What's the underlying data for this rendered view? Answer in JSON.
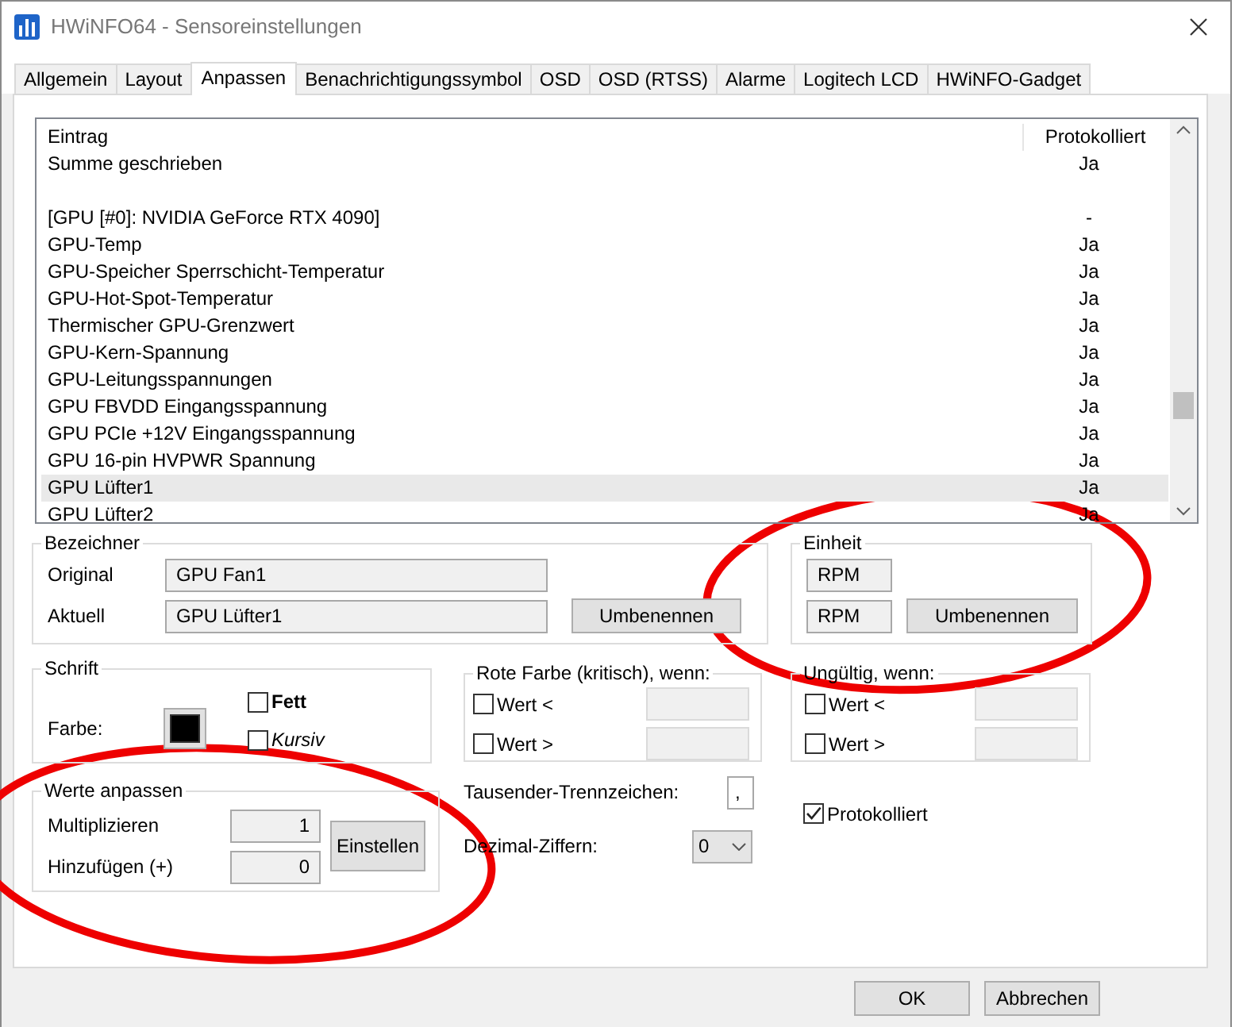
{
  "window": {
    "title": "HWiNFO64 - Sensoreinstellungen"
  },
  "tabs": [
    {
      "label": "Allgemein",
      "selected": false
    },
    {
      "label": "Layout",
      "selected": false
    },
    {
      "label": "Anpassen",
      "selected": true
    },
    {
      "label": "Benachrichtigungssymbol",
      "selected": false
    },
    {
      "label": "OSD",
      "selected": false
    },
    {
      "label": "OSD (RTSS)",
      "selected": false
    },
    {
      "label": "Alarme",
      "selected": false
    },
    {
      "label": "Logitech LCD",
      "selected": false
    },
    {
      "label": "HWiNFO-Gadget",
      "selected": false
    }
  ],
  "sensor_list": {
    "columns": [
      "Eintrag",
      "Protokolliert"
    ],
    "rows": [
      {
        "kind": "entry",
        "entry": "Summe geschrieben",
        "logged": "Ja",
        "selected": false
      },
      {
        "kind": "spacer"
      },
      {
        "kind": "entry",
        "entry": "[GPU [#0]: NVIDIA GeForce RTX 4090]",
        "logged": "-",
        "selected": false
      },
      {
        "kind": "entry",
        "entry": "GPU-Temp",
        "logged": "Ja",
        "selected": false
      },
      {
        "kind": "entry",
        "entry": "GPU-Speicher Sperrschicht-Temperatur",
        "logged": "Ja",
        "selected": false
      },
      {
        "kind": "entry",
        "entry": "GPU-Hot-Spot-Temperatur",
        "logged": "Ja",
        "selected": false
      },
      {
        "kind": "entry",
        "entry": "Thermischer GPU-Grenzwert",
        "logged": "Ja",
        "selected": false
      },
      {
        "kind": "entry",
        "entry": "GPU-Kern-Spannung",
        "logged": "Ja",
        "selected": false
      },
      {
        "kind": "entry",
        "entry": "GPU-Leitungsspannungen",
        "logged": "Ja",
        "selected": false
      },
      {
        "kind": "entry",
        "entry": "GPU FBVDD Eingangsspannung",
        "logged": "Ja",
        "selected": false
      },
      {
        "kind": "entry",
        "entry": "GPU PCIe +12V Eingangsspannung",
        "logged": "Ja",
        "selected": false
      },
      {
        "kind": "entry",
        "entry": "GPU 16-pin HVPWR Spannung",
        "logged": "Ja",
        "selected": false
      },
      {
        "kind": "entry",
        "entry": "GPU Lüfter1",
        "logged": "Ja",
        "selected": true
      },
      {
        "kind": "entry",
        "entry": "GPU Lüfter2",
        "logged": "Ja",
        "selected": false
      }
    ]
  },
  "label_group": {
    "title": "Bezeichner",
    "original_label": "Original",
    "original_value": "GPU Fan1",
    "current_label": "Aktuell",
    "current_value": "GPU Lüfter1",
    "rename_button": "Umbenennen"
  },
  "unit_group": {
    "title": "Einheit",
    "original_value": "RPM",
    "current_value": "RPM",
    "rename_button": "Umbenennen"
  },
  "font_group": {
    "title": "Schrift",
    "color_label": "Farbe:",
    "color": "#000000",
    "options": [
      {
        "label": "Fett",
        "checked": false
      },
      {
        "label": "Kursiv",
        "checked": false
      }
    ]
  },
  "red_group": {
    "title": "Rote Farbe (kritisch), wenn:",
    "conditions": [
      {
        "label": "Wert <",
        "checked": false
      },
      {
        "label": "Wert >",
        "checked": false
      }
    ]
  },
  "invalid_group": {
    "title": "Ungültig, wenn:",
    "conditions": [
      {
        "label": "Wert <",
        "checked": false
      },
      {
        "label": "Wert >",
        "checked": false
      }
    ]
  },
  "adjust_group": {
    "title": "Werte anpassen",
    "multiply_label": "Multiplizieren",
    "multiply_value": "1",
    "add_label": "Hinzufügen (+)",
    "add_value": "0",
    "apply_button": "Einstellen"
  },
  "thousands": {
    "label": "Tausender-Trennzeichen:",
    "value": ","
  },
  "decimals": {
    "label": "Dezimal-Ziffern:",
    "value": "0"
  },
  "logged": {
    "label": "Protokolliert",
    "checked": true
  },
  "buttons": [
    "OK",
    "Abbrechen"
  ],
  "annotations": [
    {
      "kind": "ellipse",
      "color": "#ee0000"
    },
    {
      "kind": "ellipse",
      "color": "#ee0000"
    }
  ]
}
